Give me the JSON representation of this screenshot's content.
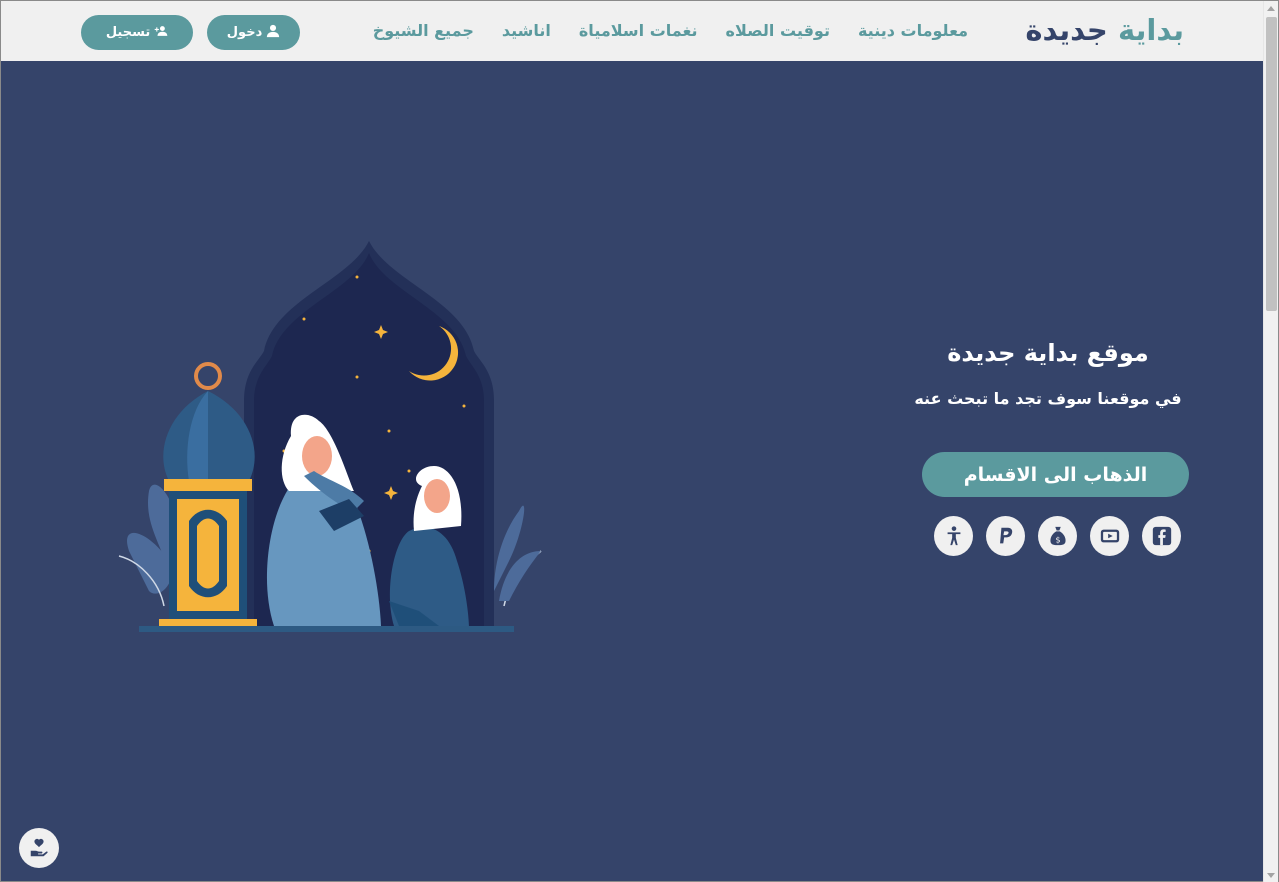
{
  "navbar": {
    "brand_part1": "بداية",
    "brand_part2": "جديدة",
    "links": [
      "جميع الشيوخ",
      "اناشيد",
      "نغمات اسلامياة",
      "توقيت الصلاه",
      "معلومات دينية"
    ],
    "login_label": "دخول",
    "register_label": "تسجيل"
  },
  "hero": {
    "title": "موقع بداية جديدة",
    "subtitle": "في موقعنا سوف تجد ما تبحث عنه",
    "cta_label": "الذهاب الى الاقسام"
  },
  "socials": [
    "accessibility-icon",
    "paypal-icon",
    "money-bag-icon",
    "youtube-icon",
    "facebook-icon"
  ],
  "colors": {
    "background": "#35446a",
    "accent": "#5b9a9e",
    "navbar": "#f0f0f0"
  }
}
